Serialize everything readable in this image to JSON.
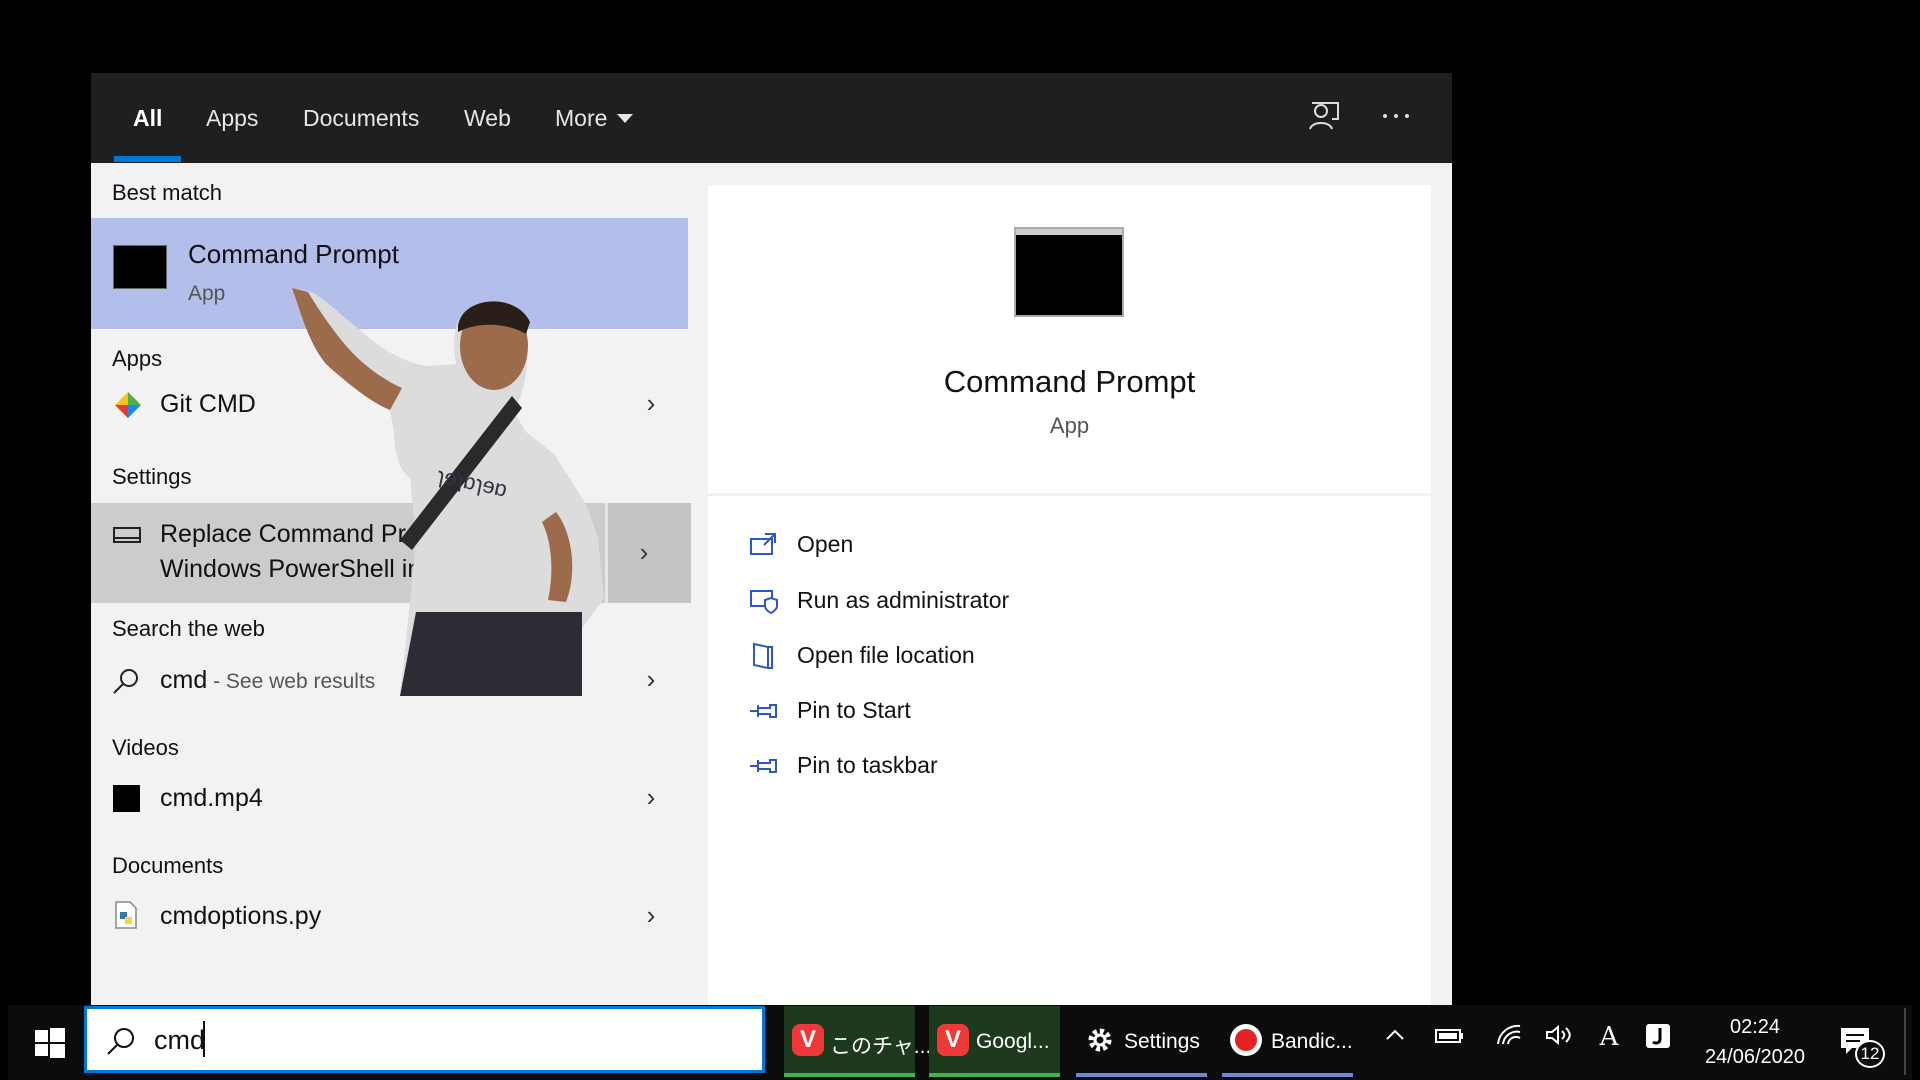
{
  "colors": {
    "accent": "#0078d7",
    "selected_row": "#b3bfea",
    "hover_row": "#cccccc",
    "tab_bar": "#1f1f1f",
    "vivaldi_red": "#ef3939",
    "running_green": "#3fb54a"
  },
  "tabs": [
    {
      "label": "All",
      "active": true
    },
    {
      "label": "Apps"
    },
    {
      "label": "Documents"
    },
    {
      "label": "Web"
    },
    {
      "label": "More"
    }
  ],
  "top_icons": [
    "feedback-icon",
    "more-options-icon"
  ],
  "results": {
    "best_match": {
      "heading": "Best match",
      "item": {
        "title": "Command Prompt",
        "subtitle": "App",
        "icon": "cmd-icon"
      }
    },
    "apps": {
      "heading": "Apps",
      "item": {
        "bold": "Git CMD",
        "icon": "git-icon"
      }
    },
    "settings": {
      "heading": "Settings",
      "line1": "Replace Command Prompt with",
      "line2": "Windows PowerShell in the Win + X",
      "icon": "display-icon"
    },
    "web": {
      "heading": "Search the web",
      "bold": "cmd",
      "suffix": " - See web results",
      "icon": "search-icon"
    },
    "videos": {
      "heading": "Videos",
      "bold": "cmd",
      "rest": ".mp4",
      "icon": "video-file-icon"
    },
    "documents": {
      "heading": "Documents",
      "bold": "cmd",
      "rest": "options.py",
      "icon": "python-file-icon"
    }
  },
  "preview": {
    "title": "Command Prompt",
    "subtitle": "App",
    "actions": [
      {
        "label": "Open",
        "icon": "open-icon"
      },
      {
        "label": "Run as administrator",
        "icon": "shield-icon"
      },
      {
        "label": "Open file location",
        "icon": "file-location-icon"
      },
      {
        "label": "Pin to Start",
        "icon": "pin-icon"
      },
      {
        "label": "Pin to taskbar",
        "icon": "pin-icon"
      }
    ]
  },
  "taskbar": {
    "search_value": "cmd",
    "apps": [
      {
        "label": "このチャ...",
        "icon": "vivaldi-icon"
      },
      {
        "label": "Googl...",
        "icon": "vivaldi-icon"
      },
      {
        "label": "Settings",
        "icon": "gear-icon"
      },
      {
        "label": "Bandic...",
        "icon": "record-icon"
      }
    ],
    "ime": "A",
    "time": "02:24",
    "date": "24/06/2020",
    "notification_count": "12"
  }
}
